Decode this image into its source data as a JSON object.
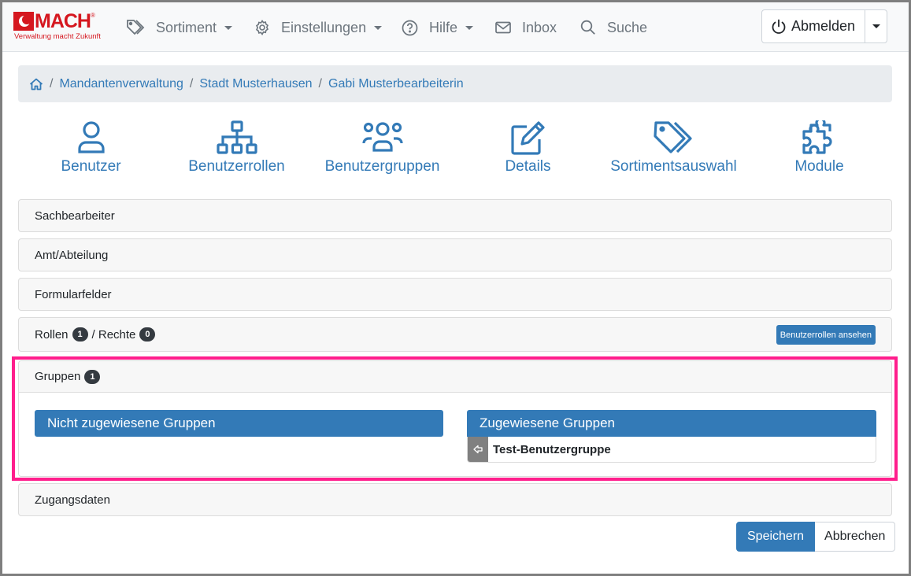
{
  "navbar": {
    "logo": {
      "brand": "MACH",
      "registered": "®",
      "tagline": "Verwaltung macht Zukunft"
    },
    "items": [
      {
        "label": "Sortiment",
        "icon": "tags-icon",
        "dropdown": true
      },
      {
        "label": "Einstellungen",
        "icon": "gear-icon",
        "dropdown": true
      },
      {
        "label": "Hilfe",
        "icon": "question-circle-icon",
        "dropdown": true
      },
      {
        "label": "Inbox",
        "icon": "envelope-icon",
        "dropdown": false
      },
      {
        "label": "Suche",
        "icon": "search-icon",
        "dropdown": false
      }
    ],
    "logout": {
      "label": "Abmelden",
      "icon": "power-icon"
    }
  },
  "breadcrumb": {
    "home_icon": "home-icon",
    "items": [
      "Mandantenverwaltung",
      "Stadt Musterhausen",
      "Gabi Musterbearbeiterin"
    ],
    "separator": "/"
  },
  "icon_nav": [
    {
      "label": "Benutzer",
      "icon": "user-icon"
    },
    {
      "label": "Benutzerrollen",
      "icon": "sitemap-icon"
    },
    {
      "label": "Benutzergruppen",
      "icon": "users-icon"
    },
    {
      "label": "Details",
      "icon": "edit-icon"
    },
    {
      "label": "Sortimentsauswahl",
      "icon": "tags-icon"
    },
    {
      "label": "Module",
      "icon": "puzzle-icon"
    }
  ],
  "panels": {
    "sachbearbeiter": "Sachbearbeiter",
    "amt": "Amt/Abteilung",
    "formular": "Formularfelder",
    "rollen": {
      "label": "Rollen",
      "count": "1",
      "sep": "/ Rechte",
      "rechte_count": "0",
      "button": "Benutzerrollen ansehen"
    },
    "gruppen": {
      "label": "Gruppen",
      "count": "1",
      "unassigned_title": "Nicht zugewiesene Gruppen",
      "assigned_title": "Zugewiesene Gruppen",
      "assigned": [
        "Test-Benutzergruppe"
      ]
    },
    "zugangsdaten": "Zugangsdaten"
  },
  "actions": {
    "save": "Speichern",
    "cancel": "Abbrechen"
  },
  "colors": {
    "primary": "#337ab7",
    "brand": "#d5171f",
    "highlight": "#ff1e8c",
    "badge": "#343a40"
  }
}
